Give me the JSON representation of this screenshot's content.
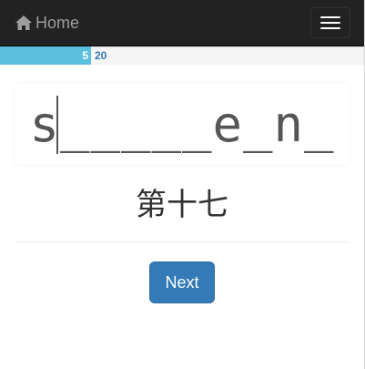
{
  "navbar": {
    "brand_label": "Home",
    "brand_icon": "home-icon",
    "toggle_icon": "hamburger-menu-icon",
    "background": "#222222"
  },
  "progress": {
    "current": 5,
    "current_label": "5",
    "total": 20,
    "total_label": "20",
    "fraction": 0.2,
    "fill_color": "#5bc0de"
  },
  "puzzle": {
    "word_display": "s_____e_n_",
    "clue": "第十七"
  },
  "actions": {
    "next_label": "Next",
    "next_color": "#337ab7"
  }
}
